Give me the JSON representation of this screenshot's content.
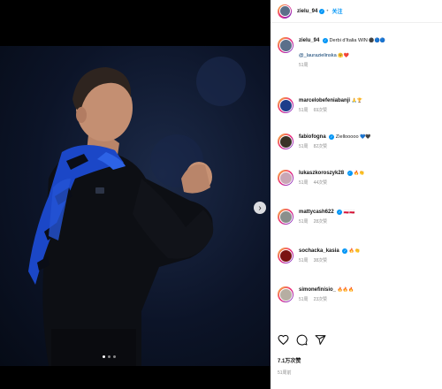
{
  "post": {
    "username": "zielu_94",
    "follow_label": "关注"
  },
  "caption": {
    "username": "zielu_94",
    "text": "Derbi d'Italia WIN",
    "mention": "@_laurazielinska",
    "time": "51周"
  },
  "comments": [
    {
      "username": "marcelobefeniabanji",
      "text": "",
      "time": "51周",
      "likes": "69次赞"
    },
    {
      "username": "fabiofogna",
      "text": "Ziellooooo",
      "time": "51周",
      "likes": "82次赞"
    },
    {
      "username": "lukaszkoroszyk28",
      "text": "",
      "time": "51周",
      "likes": "44次赞"
    },
    {
      "username": "mattycash622",
      "text": "",
      "time": "51周",
      "likes": "28次赞"
    },
    {
      "username": "sochacka_kasia",
      "text": "",
      "time": "51周",
      "likes": "38次赞"
    },
    {
      "username": "simonefinisio_",
      "text": "",
      "time": "51周",
      "likes": "23次赞"
    }
  ],
  "stats": {
    "likes": "7.1万次赞",
    "date": "51周前"
  },
  "icons": [
    "heart-icon",
    "comment-icon",
    "share-icon",
    "next-arrow-icon"
  ],
  "colors": {
    "accent": "#0095f6",
    "background": "#ffffff",
    "media_bg": "#000000"
  }
}
